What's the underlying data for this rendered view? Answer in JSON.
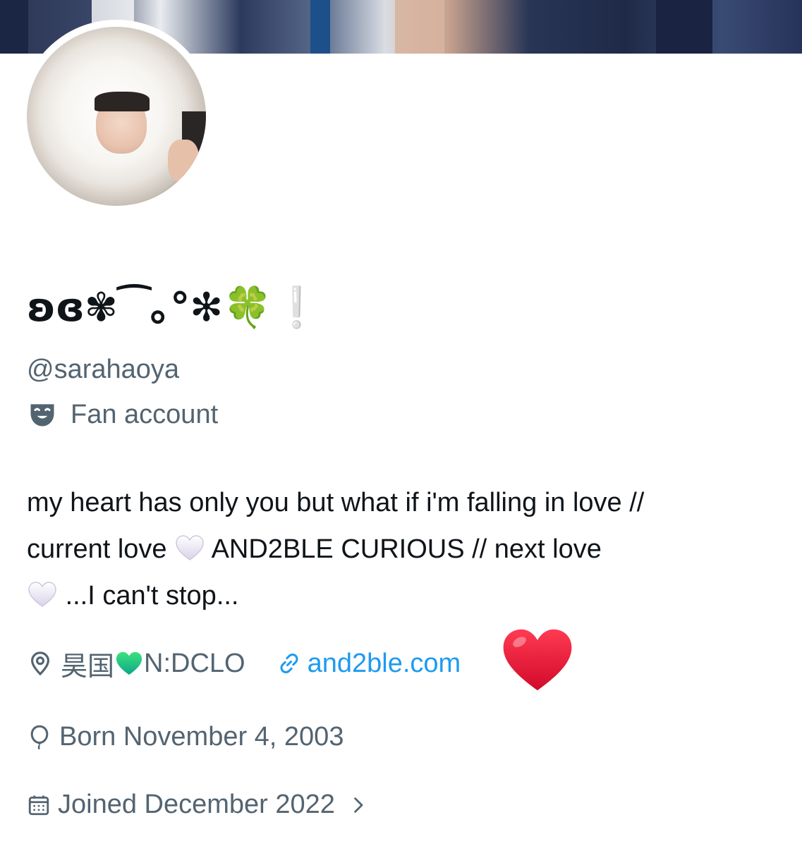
{
  "profile": {
    "display_name": "ʚɞ✾⁀｡°✻🍀",
    "display_name_end": "❕",
    "handle": "@sarahaoya",
    "label": "Fan account",
    "label_icon": "mask-icon",
    "bio": {
      "line1": "my heart has only you but what if i'm falling in love //",
      "line2_a": "current love",
      "line2_b": "AND2BLE CURIOUS // next love",
      "line3": "...I can't stop..."
    },
    "location_a": "昊国",
    "location_b": "N:DCLO",
    "website": "and2ble.com",
    "born": "Born November 4, 2003",
    "joined": "Joined December 2022"
  },
  "colors": {
    "text": "#0f1419",
    "secondary": "#536471",
    "link": "#1d9bf0",
    "heart_red": "#e0142f"
  }
}
